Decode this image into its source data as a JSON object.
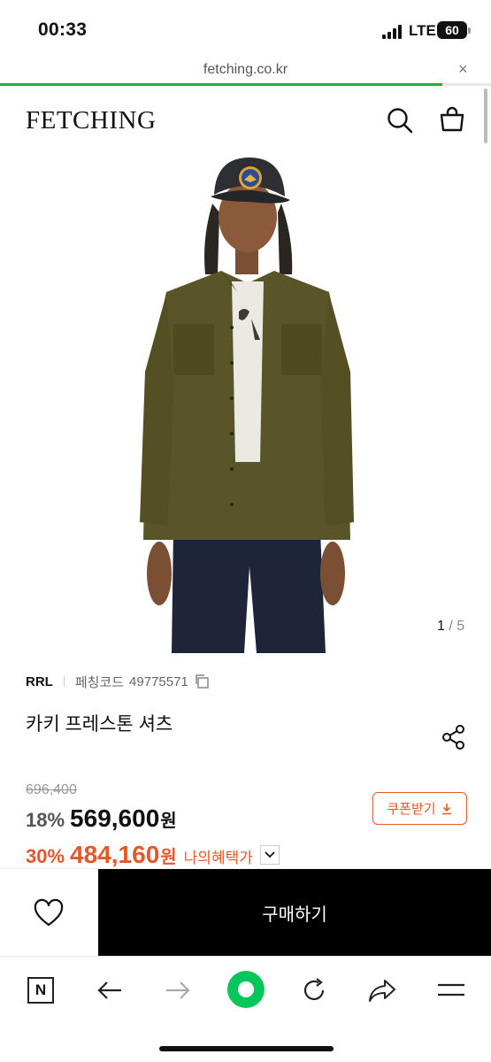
{
  "status_bar": {
    "time": "00:33",
    "network": "LTE",
    "battery": "60"
  },
  "browser": {
    "url": "fetching.co.kr",
    "close_glyph": "×",
    "load_progress": 0.9
  },
  "header": {
    "logo": "FETCHING"
  },
  "gallery": {
    "current": "1",
    "separator": "/",
    "total": "5"
  },
  "product": {
    "brand": "RRL",
    "code_label": "페칭코드",
    "code": "49775571",
    "name": "카키 프레스톤 셔츠",
    "original_price": "696,400",
    "discount_rate": "18%",
    "price": "569,600",
    "currency": "원",
    "benefit_rate": "30%",
    "benefit_price": "484,160",
    "benefit_label": "나의혜택가"
  },
  "coupon": {
    "label": "쿠폰받기"
  },
  "buy_bar": {
    "buy_label": "구매하기"
  },
  "colors": {
    "accent": "#e4582a",
    "progress": "#1db33a",
    "naver_green": "#03c75a",
    "shirt": "#5a5528"
  },
  "toolbar": {
    "n_button": "N"
  }
}
